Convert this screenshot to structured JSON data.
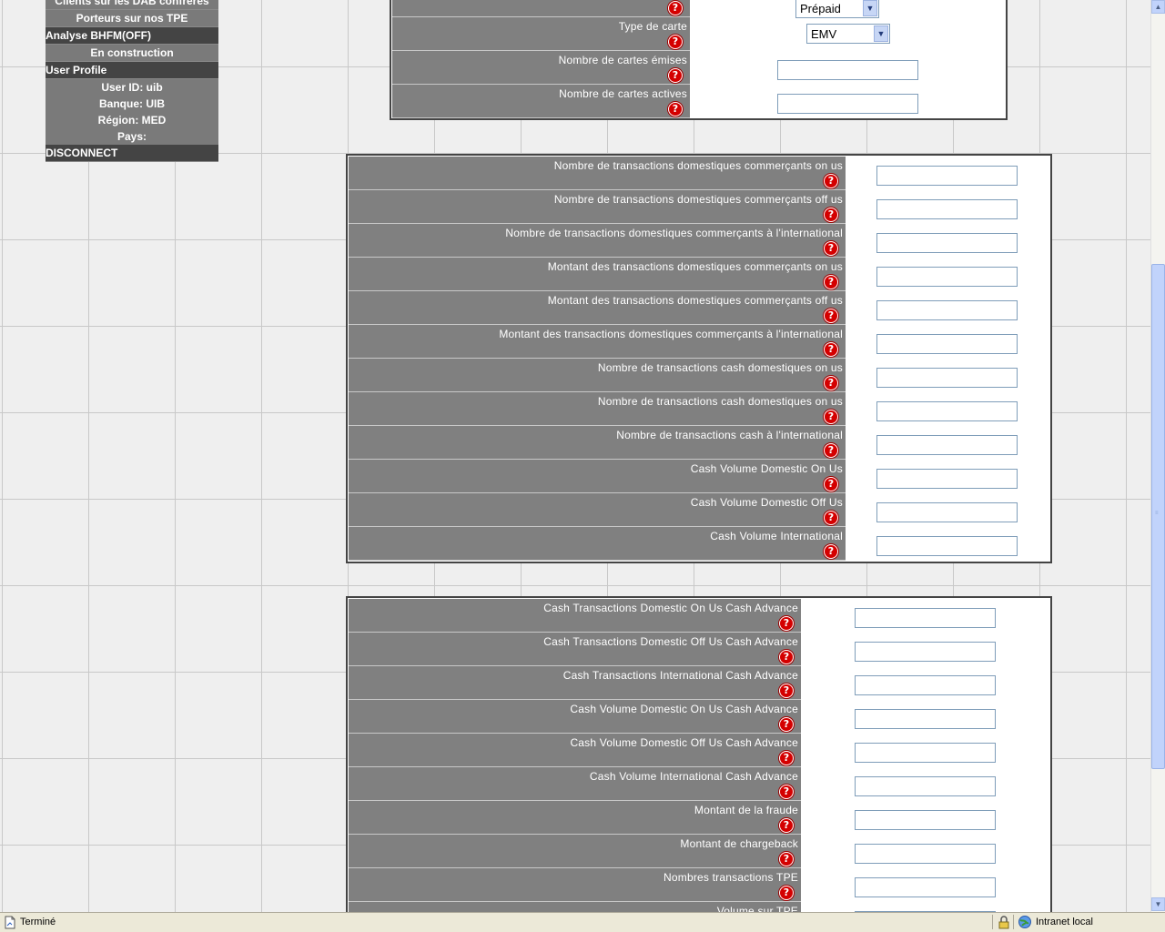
{
  "sidebar": {
    "rows": [
      {
        "text": "Clients sur les DAB confrères",
        "type": "item"
      },
      {
        "text": "Porteurs sur nos TPE",
        "type": "item"
      },
      {
        "text": "Analyse BHFM(OFF)",
        "type": "hdr"
      },
      {
        "text": "En construction",
        "type": "item"
      },
      {
        "text": "User Profile",
        "type": "hdr"
      },
      {
        "text": "User ID: uib",
        "type": "info"
      },
      {
        "text": "Banque: UIB",
        "type": "info"
      },
      {
        "text": "Région: MED",
        "type": "info"
      },
      {
        "text": "Pays:",
        "type": "info"
      },
      {
        "text": "DISCONNECT",
        "type": "hdr"
      }
    ]
  },
  "help_glyph": "?",
  "panel1": {
    "rows": [
      {
        "label": "",
        "kind": "select",
        "value": "Prépaid"
      },
      {
        "label": "Type de carte",
        "kind": "select",
        "value": "EMV"
      },
      {
        "label": "Nombre de cartes émises",
        "kind": "input",
        "value": ""
      },
      {
        "label": "Nombre de cartes actives",
        "kind": "input",
        "value": ""
      }
    ]
  },
  "panel2": {
    "rows": [
      {
        "label": "Nombre de transactions domestiques commerçants on us",
        "value": ""
      },
      {
        "label": "Nombre de transactions domestiques commerçants off us",
        "value": ""
      },
      {
        "label": "Nombre de transactions domestiques commerçants à l'international",
        "value": ""
      },
      {
        "label": "Montant des transactions domestiques commerçants on us",
        "value": ""
      },
      {
        "label": "Montant des transactions domestiques commerçants off us",
        "value": ""
      },
      {
        "label": "Montant des transactions domestiques commerçants à l'international",
        "value": ""
      },
      {
        "label": "Nombre de transactions cash domestiques on us",
        "value": ""
      },
      {
        "label": "Nombre de transactions cash domestiques on us",
        "value": ""
      },
      {
        "label": "Nombre de transactions cash à l'international",
        "value": ""
      },
      {
        "label": "Cash Volume Domestic On Us",
        "value": ""
      },
      {
        "label": "Cash Volume Domestic Off Us",
        "value": ""
      },
      {
        "label": "Cash Volume International",
        "value": ""
      }
    ]
  },
  "panel3": {
    "rows": [
      {
        "label": "Cash Transactions Domestic On Us Cash Advance",
        "value": ""
      },
      {
        "label": "Cash Transactions Domestic Off Us Cash Advance",
        "value": ""
      },
      {
        "label": "Cash Transactions International Cash Advance",
        "value": ""
      },
      {
        "label": "Cash Volume Domestic On Us Cash Advance",
        "value": ""
      },
      {
        "label": "Cash Volume Domestic Off Us Cash Advance",
        "value": ""
      },
      {
        "label": "Cash Volume International Cash Advance",
        "value": ""
      },
      {
        "label": "Montant de la fraude",
        "value": ""
      },
      {
        "label": "Montant de chargeback",
        "value": ""
      },
      {
        "label": "Nombres transactions TPE",
        "value": ""
      },
      {
        "label": "Volume sur TPE",
        "value": ""
      }
    ]
  },
  "status": {
    "text": "Terminé",
    "zone": "Intranet local",
    "icons": [
      "page-icon",
      "lock-icon",
      "globe-icon"
    ]
  }
}
